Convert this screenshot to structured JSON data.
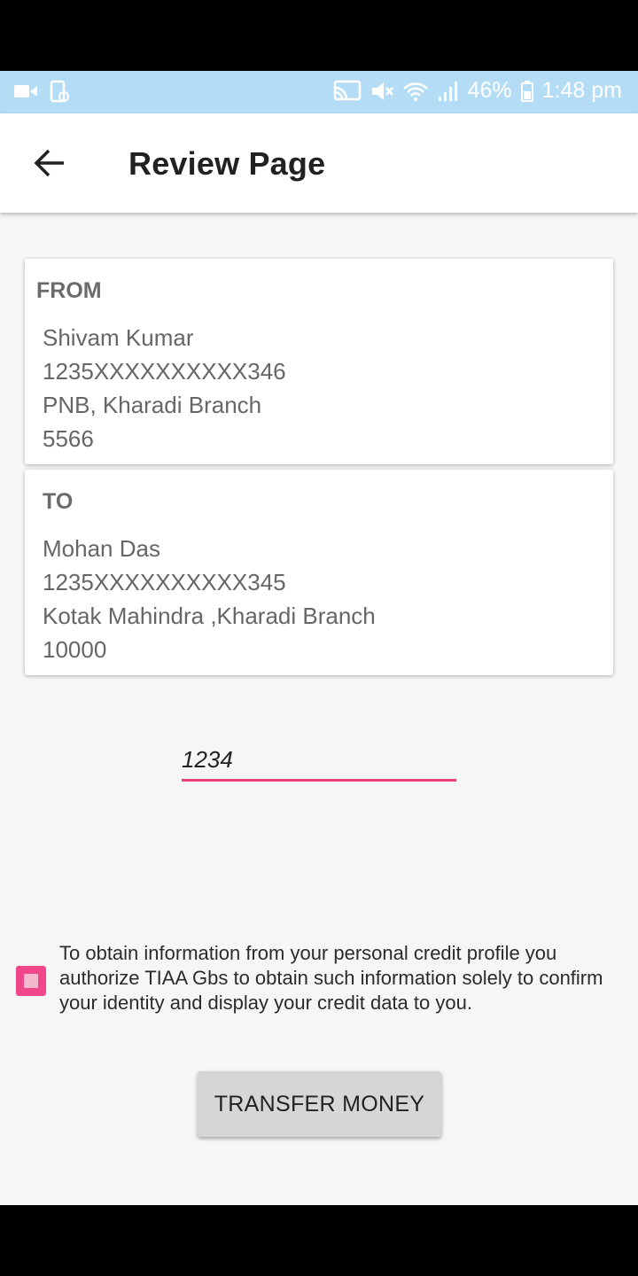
{
  "status_bar": {
    "battery": "46%",
    "time": "1:48 pm",
    "icons": [
      "video-camera-icon",
      "tablet-icon",
      "cast-icon",
      "mute-icon",
      "wifi-icon",
      "signal-icon",
      "battery-icon"
    ]
  },
  "app_bar": {
    "title": "Review Page",
    "back_icon": "arrow-left-icon"
  },
  "from_card": {
    "label": "FROM",
    "name": "Shivam Kumar",
    "account": "1235XXXXXXXXXX346",
    "bank": "PNB, Kharadi Branch",
    "amount": "5566"
  },
  "to_card": {
    "label": "TO",
    "name": "Mohan Das",
    "account": "1235XXXXXXXXXX345",
    "bank": "Kotak Mahindra ,Kharadi Branch",
    "amount": "10000"
  },
  "pin_field": {
    "value": "1234"
  },
  "consent": {
    "text": "To obtain information from your personal credit profile you authorize TIAA Gbs to obtain such information solely to confirm your identity and display your credit data to you.",
    "checked": false
  },
  "transfer_button": {
    "label": "TRANSFER MONEY"
  },
  "colors": {
    "status_bar": "#b4dcf4",
    "accent": "#e8407a",
    "button": "#d6d6d6"
  }
}
